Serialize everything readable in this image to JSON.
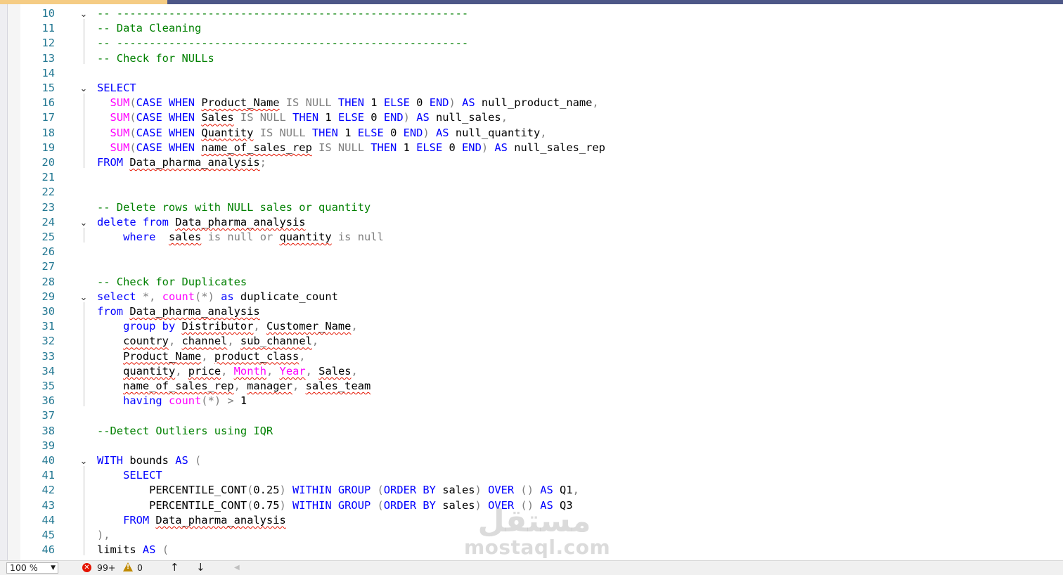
{
  "editor": {
    "lines": [
      {
        "n": "10",
        "fold": "⌄",
        "code": [
          [
            "cm",
            "-- ------------------------------------------------------"
          ]
        ]
      },
      {
        "n": "11",
        "fold": "",
        "code": [
          [
            "cm",
            "-- Data Cleaning"
          ]
        ]
      },
      {
        "n": "12",
        "fold": "",
        "code": [
          [
            "cm",
            "-- ------------------------------------------------------"
          ]
        ]
      },
      {
        "n": "13",
        "fold": "",
        "code": [
          [
            "cm",
            "-- Check for NULLs"
          ]
        ]
      },
      {
        "n": "14",
        "fold": "",
        "code": []
      },
      {
        "n": "15",
        "fold": "⌄",
        "code": [
          [
            "kw",
            "SELECT"
          ]
        ]
      },
      {
        "n": "16",
        "fold": "",
        "code": [
          [
            "t",
            "  "
          ],
          [
            "fn",
            "SUM"
          ],
          [
            "gr",
            "("
          ],
          [
            "kw",
            "CASE WHEN "
          ],
          [
            "sq",
            "Product_Name"
          ],
          [
            "gr",
            " IS NULL "
          ],
          [
            "kw",
            "THEN "
          ],
          [
            "t",
            "1 "
          ],
          [
            "kw",
            "ELSE "
          ],
          [
            "t",
            "0 "
          ],
          [
            "kw",
            "END"
          ],
          [
            "gr",
            ") "
          ],
          [
            "kw",
            "AS "
          ],
          [
            "t",
            "null_product_name"
          ],
          [
            "gr",
            ","
          ]
        ]
      },
      {
        "n": "17",
        "fold": "",
        "code": [
          [
            "t",
            "  "
          ],
          [
            "fn",
            "SUM"
          ],
          [
            "gr",
            "("
          ],
          [
            "kw",
            "CASE WHEN "
          ],
          [
            "sq",
            "Sales"
          ],
          [
            "gr",
            " IS NULL "
          ],
          [
            "kw",
            "THEN "
          ],
          [
            "t",
            "1 "
          ],
          [
            "kw",
            "ELSE "
          ],
          [
            "t",
            "0 "
          ],
          [
            "kw",
            "END"
          ],
          [
            "gr",
            ") "
          ],
          [
            "kw",
            "AS "
          ],
          [
            "t",
            "null_sales"
          ],
          [
            "gr",
            ","
          ]
        ]
      },
      {
        "n": "18",
        "fold": "",
        "code": [
          [
            "t",
            "  "
          ],
          [
            "fn",
            "SUM"
          ],
          [
            "gr",
            "("
          ],
          [
            "kw",
            "CASE WHEN "
          ],
          [
            "sq",
            "Quantity"
          ],
          [
            "gr",
            " IS NULL "
          ],
          [
            "kw",
            "THEN "
          ],
          [
            "t",
            "1 "
          ],
          [
            "kw",
            "ELSE "
          ],
          [
            "t",
            "0 "
          ],
          [
            "kw",
            "END"
          ],
          [
            "gr",
            ") "
          ],
          [
            "kw",
            "AS "
          ],
          [
            "t",
            "null_quantity"
          ],
          [
            "gr",
            ","
          ]
        ]
      },
      {
        "n": "19",
        "fold": "",
        "code": [
          [
            "t",
            "  "
          ],
          [
            "fn",
            "SUM"
          ],
          [
            "gr",
            "("
          ],
          [
            "kw",
            "CASE WHEN "
          ],
          [
            "sq",
            "name_of_sales_rep"
          ],
          [
            "gr",
            " IS NULL "
          ],
          [
            "kw",
            "THEN "
          ],
          [
            "t",
            "1 "
          ],
          [
            "kw",
            "ELSE "
          ],
          [
            "t",
            "0 "
          ],
          [
            "kw",
            "END"
          ],
          [
            "gr",
            ") "
          ],
          [
            "kw",
            "AS "
          ],
          [
            "t",
            "null_sales_rep"
          ]
        ]
      },
      {
        "n": "20",
        "fold": "",
        "code": [
          [
            "kw",
            "FROM "
          ],
          [
            "sq",
            "Data_pharma_analysis"
          ],
          [
            "gr",
            ";"
          ]
        ]
      },
      {
        "n": "21",
        "fold": "",
        "code": []
      },
      {
        "n": "22",
        "fold": "",
        "code": []
      },
      {
        "n": "23",
        "fold": "",
        "code": [
          [
            "cm",
            "-- Delete rows with NULL sales or quantity"
          ]
        ]
      },
      {
        "n": "24",
        "fold": "⌄",
        "code": [
          [
            "kw",
            "delete from "
          ],
          [
            "sq",
            "Data_pharma_analysis"
          ]
        ]
      },
      {
        "n": "25",
        "fold": "",
        "code": [
          [
            "t",
            "    "
          ],
          [
            "kw",
            "where  "
          ],
          [
            "sq",
            "sales"
          ],
          [
            "gr",
            " is null or "
          ],
          [
            "sq",
            "quantity"
          ],
          [
            "gr",
            " is null"
          ]
        ]
      },
      {
        "n": "26",
        "fold": "",
        "code": []
      },
      {
        "n": "27",
        "fold": "",
        "code": []
      },
      {
        "n": "28",
        "fold": "",
        "code": [
          [
            "cm",
            "-- Check for Duplicates"
          ]
        ]
      },
      {
        "n": "29",
        "fold": "⌄",
        "code": [
          [
            "kw",
            "select "
          ],
          [
            "gr",
            "*, "
          ],
          [
            "fn",
            "count"
          ],
          [
            "gr",
            "(*) "
          ],
          [
            "kw",
            "as "
          ],
          [
            "t",
            "duplicate_count"
          ]
        ]
      },
      {
        "n": "30",
        "fold": "",
        "code": [
          [
            "kw",
            "from "
          ],
          [
            "sq",
            "Data_pharma_analysis"
          ]
        ]
      },
      {
        "n": "31",
        "fold": "",
        "code": [
          [
            "t",
            "    "
          ],
          [
            "kw",
            "group by "
          ],
          [
            "sq",
            "Distributor"
          ],
          [
            "gr",
            ", "
          ],
          [
            "sq",
            "Customer_Name"
          ],
          [
            "gr",
            ","
          ]
        ]
      },
      {
        "n": "32",
        "fold": "",
        "code": [
          [
            "t",
            "    "
          ],
          [
            "sq",
            "country"
          ],
          [
            "gr",
            ", "
          ],
          [
            "sq",
            "channel"
          ],
          [
            "gr",
            ", "
          ],
          [
            "sq",
            "sub_channel"
          ],
          [
            "gr",
            ","
          ]
        ]
      },
      {
        "n": "33",
        "fold": "",
        "code": [
          [
            "t",
            "    "
          ],
          [
            "sq",
            "Product_Name"
          ],
          [
            "gr",
            ", "
          ],
          [
            "sq",
            "product_class"
          ],
          [
            "gr",
            ","
          ]
        ]
      },
      {
        "n": "34",
        "fold": "",
        "code": [
          [
            "t",
            "    "
          ],
          [
            "sq",
            "quantity"
          ],
          [
            "gr",
            ", "
          ],
          [
            "sq",
            "price"
          ],
          [
            "gr",
            ", "
          ],
          [
            "sqfn",
            "Month"
          ],
          [
            "gr",
            ", "
          ],
          [
            "sqfn",
            "Year"
          ],
          [
            "gr",
            ", "
          ],
          [
            "sq",
            "Sales"
          ],
          [
            "gr",
            ","
          ]
        ]
      },
      {
        "n": "35",
        "fold": "",
        "code": [
          [
            "t",
            "    "
          ],
          [
            "sq",
            "name_of_sales_rep"
          ],
          [
            "gr",
            ", "
          ],
          [
            "sq",
            "manager"
          ],
          [
            "gr",
            ", "
          ],
          [
            "sq",
            "sales_team"
          ]
        ]
      },
      {
        "n": "36",
        "fold": "",
        "code": [
          [
            "t",
            "    "
          ],
          [
            "kw",
            "having "
          ],
          [
            "fn",
            "count"
          ],
          [
            "gr",
            "(*) > "
          ],
          [
            "t",
            "1"
          ]
        ]
      },
      {
        "n": "37",
        "fold": "",
        "code": []
      },
      {
        "n": "38",
        "fold": "",
        "code": [
          [
            "cm",
            "--Detect Outliers using IQR"
          ]
        ]
      },
      {
        "n": "39",
        "fold": "",
        "code": []
      },
      {
        "n": "40",
        "fold": "⌄",
        "code": [
          [
            "kw",
            "WITH "
          ],
          [
            "t",
            "bounds "
          ],
          [
            "kw",
            "AS "
          ],
          [
            "gr",
            "("
          ]
        ]
      },
      {
        "n": "41",
        "fold": "",
        "code": [
          [
            "t",
            "    "
          ],
          [
            "kw",
            "SELECT"
          ]
        ]
      },
      {
        "n": "42",
        "fold": "",
        "code": [
          [
            "t",
            "        PERCENTILE_CONT"
          ],
          [
            "gr",
            "("
          ],
          [
            "t",
            "0.25"
          ],
          [
            "gr",
            ") "
          ],
          [
            "kw",
            "WITHIN GROUP "
          ],
          [
            "gr",
            "("
          ],
          [
            "kw",
            "ORDER BY "
          ],
          [
            "t",
            "sales"
          ],
          [
            "gr",
            ") "
          ],
          [
            "kw",
            "OVER "
          ],
          [
            "gr",
            "() "
          ],
          [
            "kw",
            "AS "
          ],
          [
            "t",
            "Q1"
          ],
          [
            "gr",
            ","
          ]
        ]
      },
      {
        "n": "43",
        "fold": "",
        "code": [
          [
            "t",
            "        PERCENTILE_CONT"
          ],
          [
            "gr",
            "("
          ],
          [
            "t",
            "0.75"
          ],
          [
            "gr",
            ") "
          ],
          [
            "kw",
            "WITHIN GROUP "
          ],
          [
            "gr",
            "("
          ],
          [
            "kw",
            "ORDER BY "
          ],
          [
            "t",
            "sales"
          ],
          [
            "gr",
            ") "
          ],
          [
            "kw",
            "OVER "
          ],
          [
            "gr",
            "() "
          ],
          [
            "kw",
            "AS "
          ],
          [
            "t",
            "Q3"
          ]
        ]
      },
      {
        "n": "44",
        "fold": "",
        "code": [
          [
            "t",
            "    "
          ],
          [
            "kw",
            "FROM "
          ],
          [
            "sq",
            "Data_pharma_analysis"
          ]
        ]
      },
      {
        "n": "45",
        "fold": "",
        "code": [
          [
            "gr",
            "),"
          ]
        ]
      },
      {
        "n": "46",
        "fold": "",
        "code": [
          [
            "t",
            "limits "
          ],
          [
            "kw",
            "AS "
          ],
          [
            "gr",
            "("
          ]
        ]
      }
    ]
  },
  "status": {
    "zoom": "100 %",
    "zoom_caret": "▼",
    "error_count": "99+",
    "warning_count": "0",
    "nav_up": "↑",
    "nav_down": "↓",
    "scroll_left": "◀"
  },
  "watermark": {
    "arabic": "مستقل",
    "latin": "mostaql.com"
  }
}
